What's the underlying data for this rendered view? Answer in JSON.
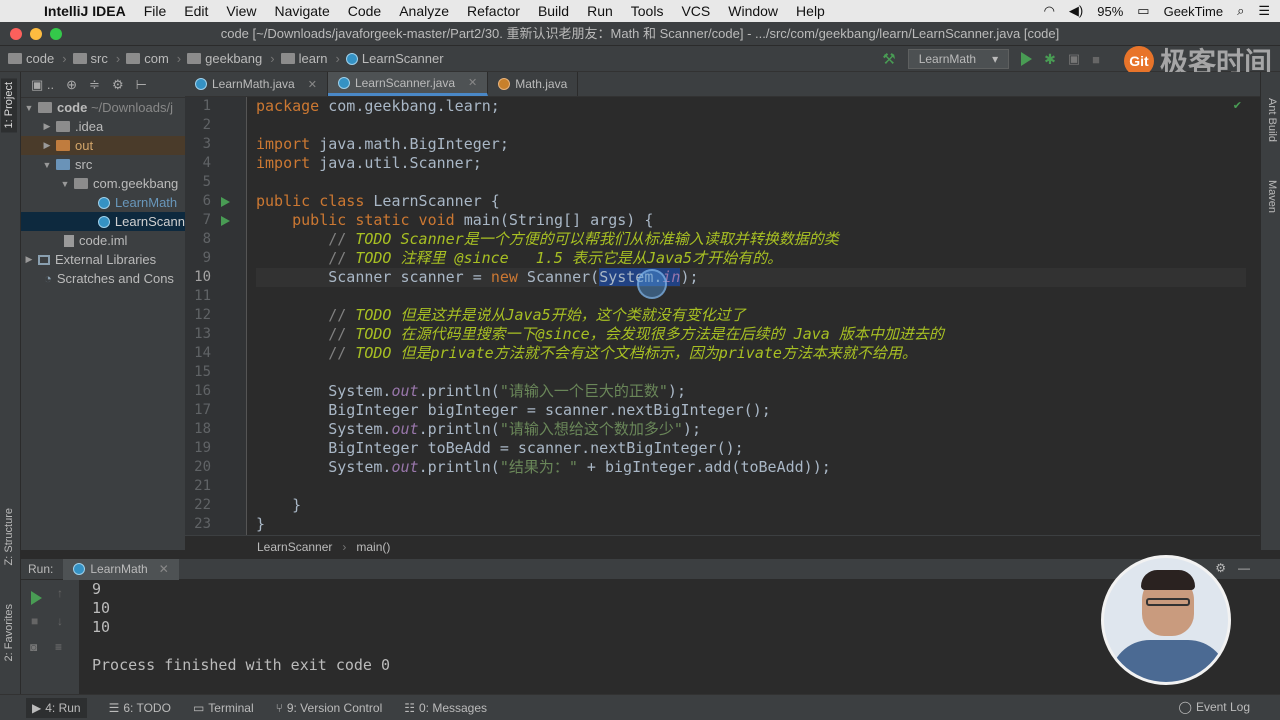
{
  "menubar": {
    "app_name": "IntelliJ IDEA",
    "items": [
      "File",
      "Edit",
      "View",
      "Navigate",
      "Code",
      "Analyze",
      "Refactor",
      "Build",
      "Run",
      "Tools",
      "VCS",
      "Window",
      "Help"
    ],
    "battery": "95%",
    "user": "GeekTime"
  },
  "window": {
    "title": "code [~/Downloads/javaforgeek-master/Part2/30. 重新认识老朋友：Math 和 Scanner/code] - .../src/com/geekbang/learn/LearnScanner.java [code]"
  },
  "navbar": {
    "crumbs": [
      "code",
      "src",
      "com",
      "geekbang",
      "learn",
      "LearnScanner"
    ],
    "run_config": "LearnMath",
    "logo_text": "极客时间"
  },
  "left_tabs": {
    "project": "1: Project",
    "structure": "Z: Structure",
    "favorites": "2: Favorites"
  },
  "right_tabs": {
    "ant": "Ant Build",
    "maven": "Maven"
  },
  "project_tree": {
    "root_name": "code",
    "root_path": "~/Downloads/j",
    "idea": ".idea",
    "out": "out",
    "src": "src",
    "package": "com.geekbang",
    "file1": "LearnMath",
    "file2": "LearnScann",
    "iml": "code.iml",
    "ext_libs": "External Libraries",
    "scratches": "Scratches and Cons"
  },
  "editor_tabs": [
    "LearnMath.java",
    "LearnScanner.java",
    "Math.java"
  ],
  "code": {
    "l1_kw": "package",
    "l1_rest": " com.geekbang.learn;",
    "l3_kw": "import",
    "l3_rest": " java.math.BigInteger;",
    "l4_kw": "import",
    "l4_rest": " java.util.Scanner;",
    "l6_kw": "public class",
    "l6_rest": " LearnScanner {",
    "l7_kw": "public static void",
    "l7_rest": " main(String[] args) {",
    "l8_cmt": "// ",
    "l8_todo": "TODO Scanner是一个方便的可以帮我们从标准输入读取并转换数据的类",
    "l9_cmt": "// ",
    "l9_todo": "TODO 注释里 @since   1.5 表示它是从Java5才开始有的。",
    "l10_a": "Scanner scanner = ",
    "l10_kw": "new",
    "l10_b": " Scanner(",
    "l10_sel": "System",
    "l10_sel2": ".",
    "l10_fld": "in",
    "l10_c": ");",
    "l12_cmt": "// ",
    "l12_todo": "TODO 但是这并是说从Java5开始，这个类就没有变化过了",
    "l13_cmt": "// ",
    "l13_todo": "TODO 在源代码里搜索一下@since，会发现很多方法是在后续的 Java 版本中加进去的",
    "l14_cmt": "// ",
    "l14_todo": "TODO 但是private方法就不会有这个文档标示，因为private方法本来就不给用。",
    "l16_a": "System.",
    "l16_fld": "out",
    "l16_b": ".println(",
    "l16_str": "\"请输入一个巨大的正数\"",
    "l16_c": ");",
    "l17": "BigInteger bigInteger = scanner.nextBigInteger();",
    "l18_a": "System.",
    "l18_fld": "out",
    "l18_b": ".println(",
    "l18_str": "\"请输入想给这个数加多少\"",
    "l18_c": ");",
    "l19": "BigInteger toBeAdd = scanner.nextBigInteger();",
    "l20_a": "System.",
    "l20_fld": "out",
    "l20_b": ".println(",
    "l20_str": "\"结果为：\"",
    "l20_c": " + bigInteger.add(toBeAdd));",
    "l22": "}",
    "l23": "}"
  },
  "line_numbers": [
    "1",
    "2",
    "3",
    "4",
    "5",
    "6",
    "7",
    "8",
    "9",
    "10",
    "11",
    "12",
    "13",
    "14",
    "15",
    "16",
    "17",
    "18",
    "19",
    "20",
    "21",
    "22",
    "23"
  ],
  "breadcrumb": {
    "class": "LearnScanner",
    "method": "main()"
  },
  "run_panel": {
    "label": "Run:",
    "tab": "LearnMath",
    "output": [
      "9",
      "10",
      "10",
      "",
      "Process finished with exit code 0"
    ]
  },
  "statusbar": {
    "run": "4: Run",
    "todo": "6: TODO",
    "terminal": "Terminal",
    "vcs": "9: Version Control",
    "messages": "0: Messages",
    "event_log": "Event Log"
  },
  "colors": {
    "background": "#2b2b2b",
    "keyword": "#cc7832",
    "todo": "#a8c023",
    "string": "#6a8759",
    "field": "#9876aa",
    "selection": "#214283"
  }
}
